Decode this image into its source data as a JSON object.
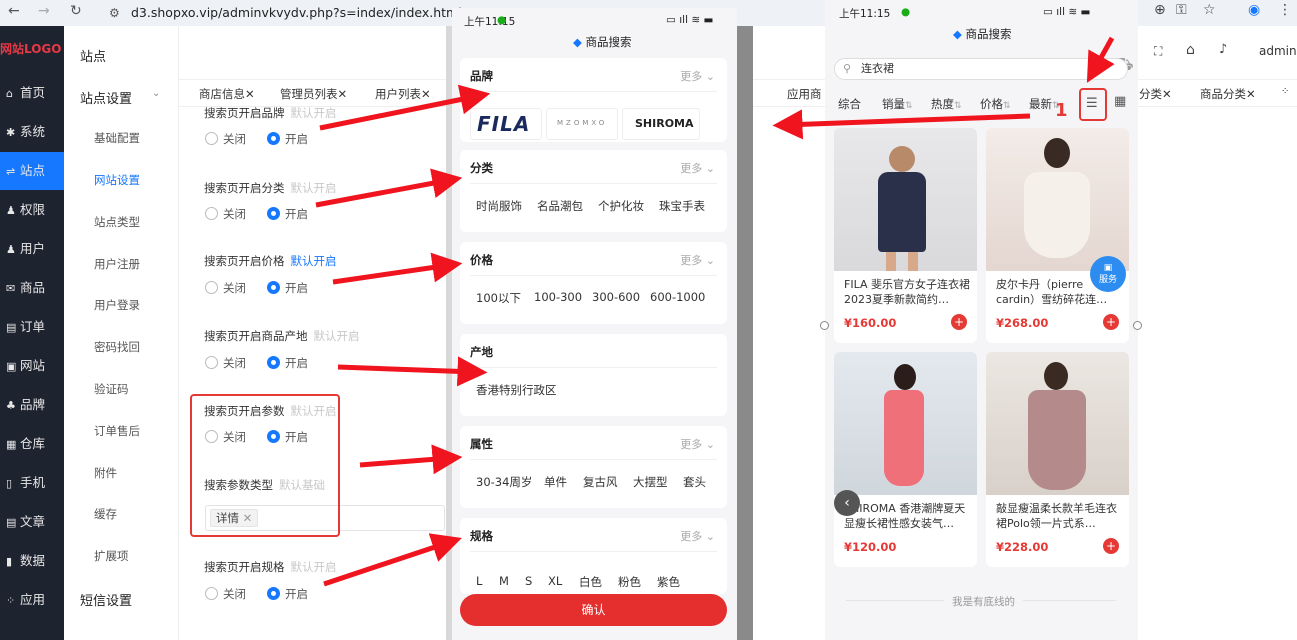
{
  "browser": {
    "url": "d3.shopxo.vip/adminvkvydv.php?s=index/index.html"
  },
  "sidebar": {
    "logo": "网站LOGO",
    "items": [
      {
        "label": "首页",
        "icon": "home-icon"
      },
      {
        "label": "系统",
        "icon": "gear-icon"
      },
      {
        "label": "站点",
        "icon": "sliders-icon"
      },
      {
        "label": "权限",
        "icon": "user-lock-icon"
      },
      {
        "label": "用户",
        "icon": "user-icon"
      },
      {
        "label": "商品",
        "icon": "mail-icon"
      },
      {
        "label": "订单",
        "icon": "order-icon"
      },
      {
        "label": "网站",
        "icon": "chat-icon"
      },
      {
        "label": "品牌",
        "icon": "users-icon"
      },
      {
        "label": "仓库",
        "icon": "warehouse-icon"
      },
      {
        "label": "手机",
        "icon": "phone-icon"
      },
      {
        "label": "文章",
        "icon": "article-icon"
      },
      {
        "label": "数据",
        "icon": "bar-chart-icon"
      },
      {
        "label": "应用",
        "icon": "apps-icon"
      }
    ]
  },
  "submenu": {
    "header": "站点",
    "group1": "站点设置",
    "items": [
      "基础配置",
      "网站设置",
      "站点类型",
      "用户注册",
      "用户登录",
      "密码找回",
      "验证码",
      "订单售后",
      "附件",
      "缓存",
      "扩展项"
    ],
    "group2": "短信设置"
  },
  "tabs": [
    "商店信息",
    "管理员列表",
    "用户列表",
    "应用商",
    "分类",
    "商品分类"
  ],
  "topbar": {
    "user": "admin"
  },
  "form": {
    "fields": [
      {
        "label": "搜索页开启品牌",
        "hint": "默认开启"
      },
      {
        "label": "搜索页开启分类",
        "hint": "默认开启"
      },
      {
        "label": "搜索页开启价格",
        "hint": "默认开启"
      },
      {
        "label": "搜索页开启商品产地",
        "hint": "默认开启"
      },
      {
        "label": "搜索页开启参数",
        "hint": "默认开启"
      },
      {
        "label": "搜索参数类型",
        "hint": "默认基础"
      },
      {
        "label": "搜索页开启规格",
        "hint": "默认开启"
      }
    ],
    "off": "关闭",
    "on": "开启",
    "param_tag": "详情"
  },
  "phone_left": {
    "time": "上午11:15",
    "title": "商品搜索",
    "sections": [
      {
        "title": "品牌",
        "more": "更多",
        "options": []
      },
      {
        "title": "分类",
        "more": "更多",
        "options": [
          "时尚服饰",
          "名品潮包",
          "个护化妆",
          "珠宝手表"
        ]
      },
      {
        "title": "价格",
        "more": "更多",
        "options": [
          "100以下",
          "100-300",
          "300-600",
          "600-1000"
        ]
      },
      {
        "title": "产地",
        "more": "",
        "options": [
          "香港特别行政区"
        ]
      },
      {
        "title": "属性",
        "more": "更多",
        "options": [
          "30-34周岁",
          "单件",
          "复古风",
          "大摆型",
          "套头"
        ]
      },
      {
        "title": "规格",
        "more": "更多",
        "options": [
          "L",
          "M",
          "S",
          "XL",
          "白色",
          "粉色",
          "紫色"
        ]
      }
    ],
    "brands": [
      "FILA",
      "MZOMXO",
      "SHIROMA"
    ],
    "confirm": "确认"
  },
  "phone_right": {
    "time": "上午11:15",
    "title": "商品搜索",
    "search_value": "连衣裙",
    "sorts": [
      "综合",
      "销量",
      "热度",
      "价格",
      "最新"
    ],
    "annotation": "1",
    "products": [
      {
        "name": "FILA 斐乐官方女子连衣裙2023夏季新款简约…",
        "price": "¥160.00"
      },
      {
        "name": "皮尔卡丹（pierre cardin）雪纺碎花连…",
        "price": "¥268.00"
      },
      {
        "name": "SHIROMA 香港潮牌夏天显瘦长裙性感女装气…",
        "price": "¥120.00"
      },
      {
        "name": "敲显瘦温柔长款羊毛连衣裙Polo领一片式系…",
        "price": "¥228.00"
      }
    ],
    "service": "服务",
    "bottom": "我是有底线的"
  },
  "colors": {
    "accent": "#1677ff",
    "danger": "#e53935",
    "sidebar_bg": "#1e2330",
    "arrow": "#f0141e"
  }
}
